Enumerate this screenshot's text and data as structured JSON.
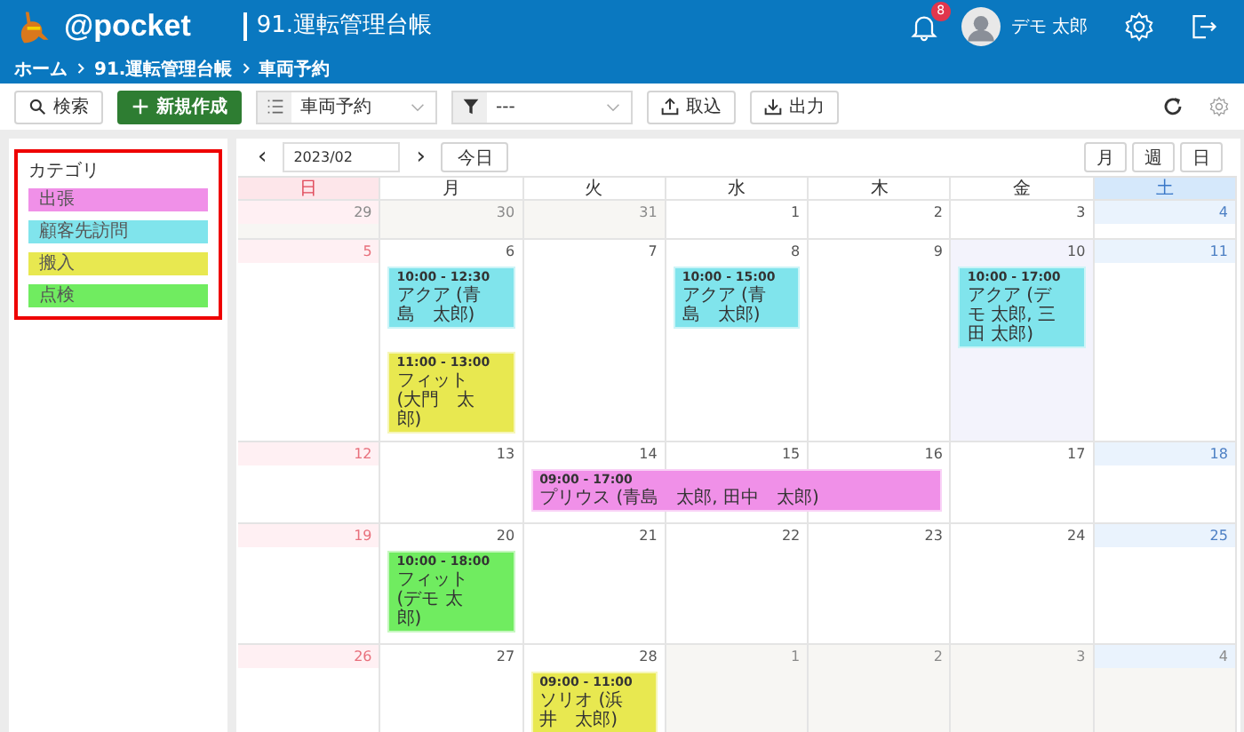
{
  "header": {
    "app_name": "@pocket",
    "title": "91.運転管理台帳",
    "breadcrumbs": [
      "ホーム",
      "91.運転管理台帳",
      "車両予約"
    ],
    "notification_count": "8",
    "user_name": "デモ 太郎"
  },
  "toolbar": {
    "search_button": "検索",
    "new_button": "新規作成",
    "view_select": {
      "value": "車両予約"
    },
    "filter_select": {
      "value": "---"
    },
    "import_button": "取込",
    "export_button": "出力"
  },
  "categories": {
    "title": "カテゴリ",
    "items": [
      {
        "label": "出張",
        "color": "#f090e8"
      },
      {
        "label": "顧客先訪問",
        "color": "#80e4ec"
      },
      {
        "label": "搬入",
        "color": "#e8e850"
      },
      {
        "label": "点検",
        "color": "#70ec60"
      }
    ]
  },
  "calendar": {
    "prev": "‹",
    "month": "2023/02",
    "next": "›",
    "today_button": "今日",
    "views": [
      "月",
      "週",
      "日"
    ],
    "weekdays": [
      "日",
      "月",
      "火",
      "水",
      "木",
      "金",
      "土"
    ],
    "weeks": [
      {
        "days": [
          {
            "date": "29",
            "outside": true,
            "today": false
          },
          {
            "date": "30",
            "outside": true,
            "today": false
          },
          {
            "date": "31",
            "outside": true,
            "today": false
          },
          {
            "date": "1",
            "outside": false,
            "today": false
          },
          {
            "date": "2",
            "outside": false,
            "today": false
          },
          {
            "date": "3",
            "outside": false,
            "today": false
          },
          {
            "date": "4",
            "outside": false,
            "today": false
          }
        ]
      },
      {
        "days": [
          {
            "date": "5",
            "outside": false,
            "today": false
          },
          {
            "date": "6",
            "outside": false,
            "today": false,
            "events": [
              {
                "kind": "event",
                "time": "10:00 - 12:30",
                "title": "アクア (青島　太郎)",
                "color": "#80e4ec"
              },
              {
                "kind": "event",
                "time": "11:00 - 13:00",
                "title": "フィット (大門　太郎)",
                "color": "#e8e850"
              }
            ]
          },
          {
            "date": "7",
            "outside": false,
            "today": false
          },
          {
            "date": "8",
            "outside": false,
            "today": false,
            "events": [
              {
                "kind": "event",
                "time": "10:00 - 15:00",
                "title": "アクア (青島　太郎)",
                "color": "#80e4ec"
              }
            ]
          },
          {
            "date": "9",
            "outside": false,
            "today": false
          },
          {
            "date": "10",
            "outside": false,
            "today": true,
            "events": [
              {
                "kind": "event",
                "time": "10:00 - 17:00",
                "title": "アクア (デモ 太郎, 三田 太郎)",
                "color": "#80e4ec"
              }
            ]
          },
          {
            "date": "11",
            "outside": false,
            "today": false
          }
        ]
      },
      {
        "days": [
          {
            "date": "12",
            "outside": false,
            "today": false
          },
          {
            "date": "13",
            "outside": false,
            "today": false
          },
          {
            "date": "14",
            "outside": false,
            "today": false,
            "events": [
              {
                "kind": "event",
                "time": "09:00 - 17:00",
                "title": "プリウス (青島　太郎, 田中　太郎)",
                "color": "#f090e8"
              }
            ]
          },
          {
            "date": "15",
            "outside": false,
            "today": false,
            "events": [
              {
                "kind": "continued"
              }
            ]
          },
          {
            "date": "16",
            "outside": false,
            "today": false,
            "events": [
              {
                "kind": "continued"
              }
            ]
          },
          {
            "date": "17",
            "outside": false,
            "today": false
          },
          {
            "date": "18",
            "outside": false,
            "today": false
          }
        ]
      },
      {
        "days": [
          {
            "date": "19",
            "outside": false,
            "today": false
          },
          {
            "date": "20",
            "outside": false,
            "today": false,
            "events": [
              {
                "kind": "event",
                "time": "10:00 - 18:00",
                "title": "フィット (デモ 太郎)",
                "color": "#70ec60"
              }
            ]
          },
          {
            "date": "21",
            "outside": false,
            "today": false
          },
          {
            "date": "22",
            "outside": false,
            "today": false
          },
          {
            "date": "23",
            "outside": false,
            "today": false
          },
          {
            "date": "24",
            "outside": false,
            "today": false
          },
          {
            "date": "25",
            "outside": false,
            "today": false
          }
        ]
      },
      {
        "days": [
          {
            "date": "26",
            "outside": false,
            "today": false
          },
          {
            "date": "27",
            "outside": false,
            "today": false
          },
          {
            "date": "28",
            "outside": false,
            "today": false,
            "events": [
              {
                "kind": "event",
                "time": "09:00 - 11:00",
                "title": "ソリオ (浜井　太郎)",
                "color": "#e8e850"
              }
            ]
          },
          {
            "date": "1",
            "outside": true,
            "today": false
          },
          {
            "date": "2",
            "outside": true,
            "today": false
          },
          {
            "date": "3",
            "outside": true,
            "today": false
          },
          {
            "date": "4",
            "outside": true,
            "today": false
          }
        ]
      }
    ]
  }
}
